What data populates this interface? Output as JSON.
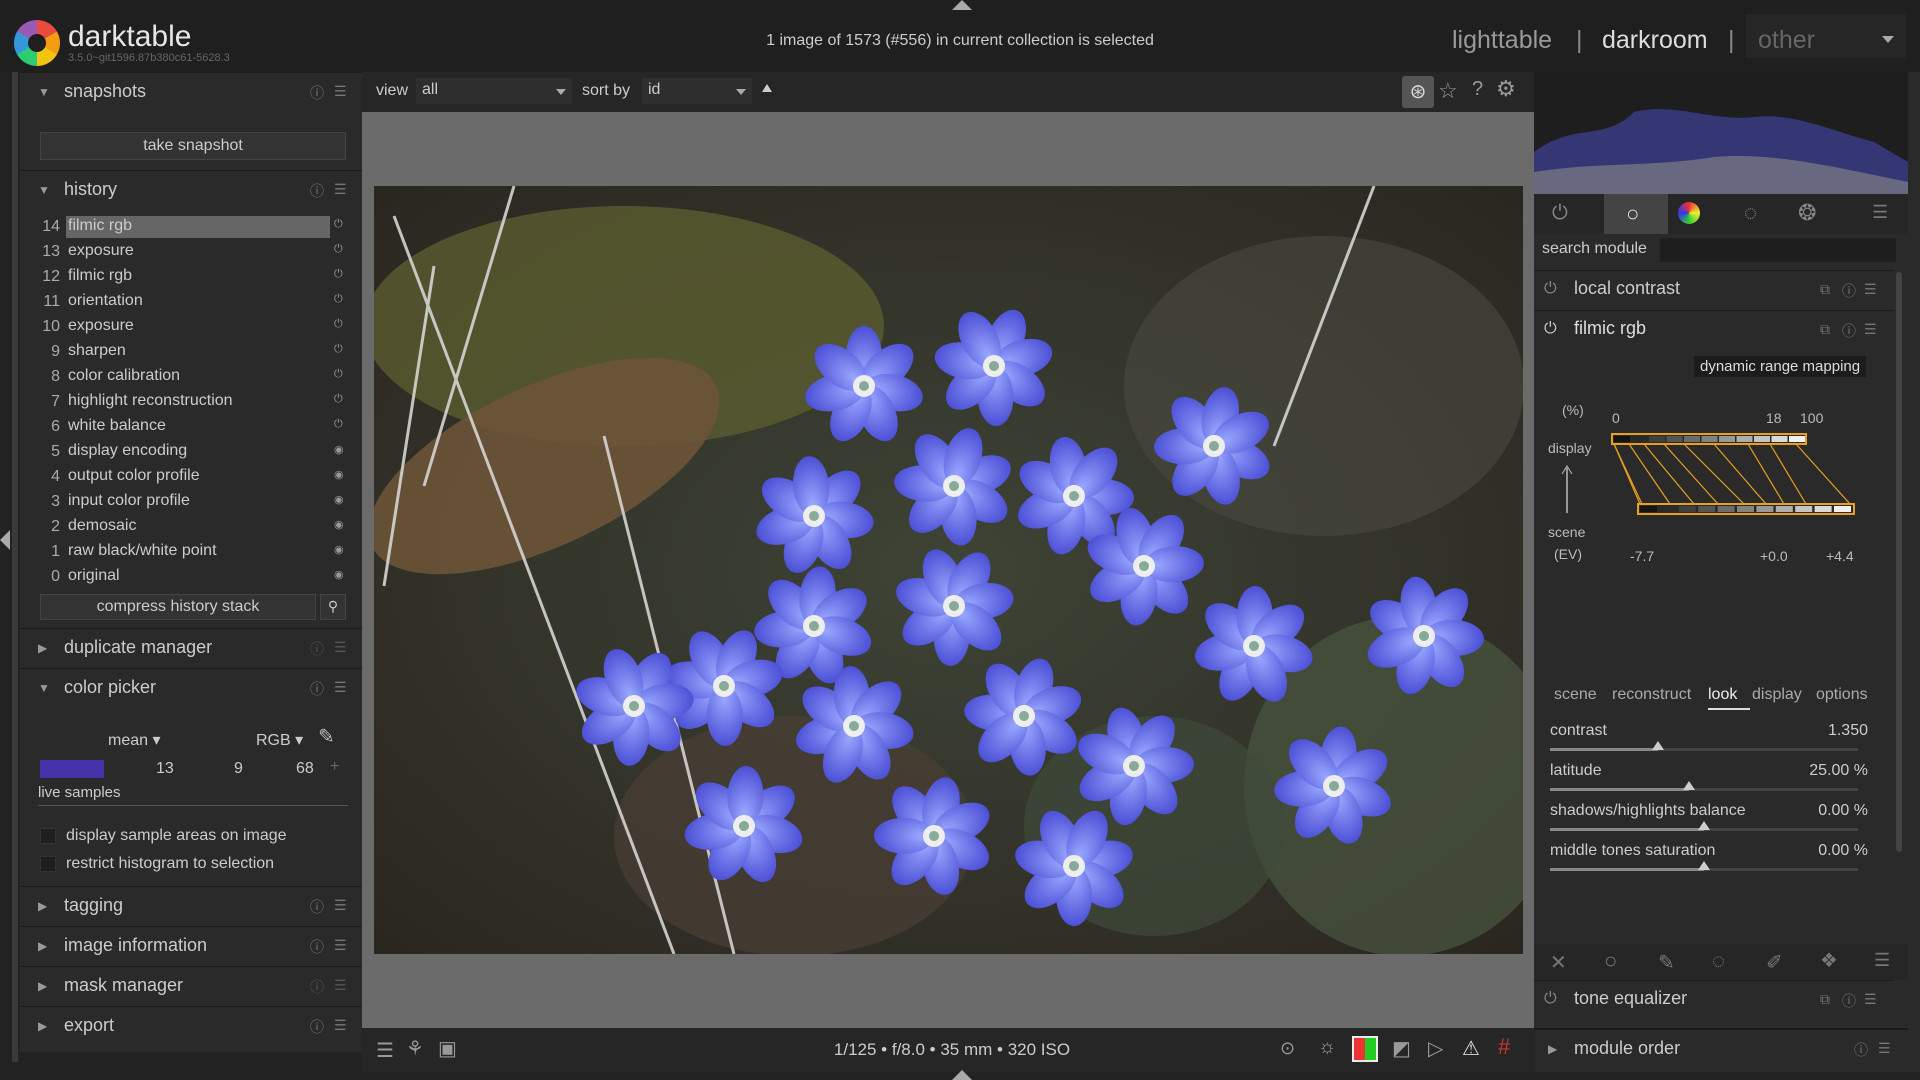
{
  "app": {
    "name": "darktable",
    "version": "3.5.0~git1596.87b380c61-5628.3"
  },
  "collection_info": "1 image of 1573 (#556) in current collection is selected",
  "views": {
    "lighttable": "lighttable",
    "darkroom": "darkroom",
    "other": "other",
    "sep": "|"
  },
  "left": {
    "snapshots": {
      "title": "snapshots",
      "take": "take snapshot"
    },
    "history": {
      "title": "history",
      "items": [
        {
          "n": "14",
          "label": "filmic rgb"
        },
        {
          "n": "13",
          "label": "exposure"
        },
        {
          "n": "12",
          "label": "filmic rgb"
        },
        {
          "n": "11",
          "label": "orientation"
        },
        {
          "n": "10",
          "label": "exposure"
        },
        {
          "n": "9",
          "label": "sharpen"
        },
        {
          "n": "8",
          "label": "color calibration"
        },
        {
          "n": "7",
          "label": "highlight reconstruction"
        },
        {
          "n": "6",
          "label": "white balance"
        },
        {
          "n": "5",
          "label": "display encoding"
        },
        {
          "n": "4",
          "label": "output color profile"
        },
        {
          "n": "3",
          "label": "input color profile"
        },
        {
          "n": "2",
          "label": "demosaic"
        },
        {
          "n": "1",
          "label": "raw black/white point"
        },
        {
          "n": "0",
          "label": "original"
        }
      ],
      "compress": "compress history stack"
    },
    "duplicate": "duplicate manager",
    "colorpicker": {
      "title": "color picker",
      "mode": "mean",
      "space": "RGB",
      "v1": "13",
      "v2": "9",
      "v3": "68",
      "swatch": "#4432a8",
      "live": "live samples",
      "opt1": "display sample areas on image",
      "opt2": "restrict histogram to selection"
    },
    "tagging": "tagging",
    "imageinfo": "image information",
    "mask": "mask manager",
    "export": "export"
  },
  "toolbar": {
    "view_label": "view",
    "view_value": "all",
    "sort_label": "sort by",
    "sort_value": "id"
  },
  "exif": "1/125 • f/8.0 • 35 mm • 320 ISO",
  "right": {
    "search_label": "search module",
    "local_contrast": "local contrast",
    "filmic": "filmic rgb",
    "drm": "dynamic range mapping",
    "graph": {
      "pct": "(%)",
      "display": "display",
      "scene": "scene",
      "ev": "(EV)",
      "t0": "0",
      "t18": "18",
      "t100": "100",
      "b1": "-7.7",
      "b2": "+0.0",
      "b3": "+4.4"
    },
    "tabs": [
      "scene",
      "reconstruct",
      "look",
      "display",
      "options"
    ],
    "sliders": [
      {
        "label": "contrast",
        "value": "1.350",
        "pos": 0.35
      },
      {
        "label": "latitude",
        "value": "25.00 %",
        "pos": 0.45
      },
      {
        "label": "shadows/highlights balance",
        "value": "0.00 %",
        "pos": 0.5
      },
      {
        "label": "middle tones saturation",
        "value": "0.00 %",
        "pos": 0.5
      }
    ],
    "tone_eq": "tone equalizer",
    "module_order": "module order"
  }
}
